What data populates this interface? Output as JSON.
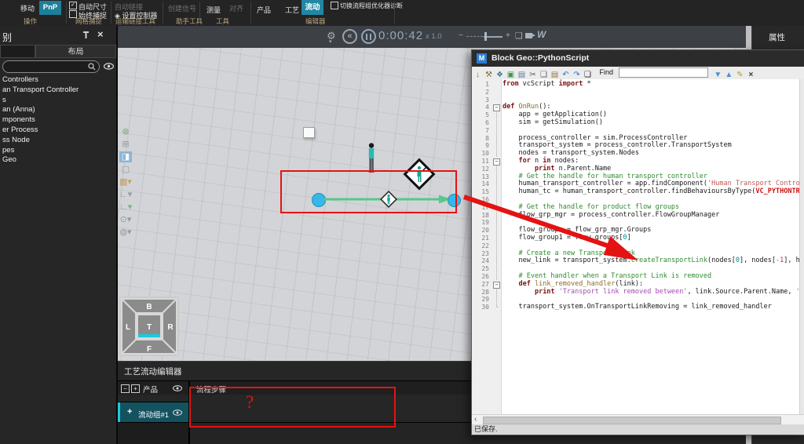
{
  "ribbon": {
    "move_label": "移动",
    "pnp_label": "PnP",
    "group_operation": "操作",
    "auto_size": "自动尺寸",
    "always_snap": "始终捕捉",
    "group_grid_snap": "网格捕捉",
    "auto_link": "自动链接",
    "set_controller": "设置控制器",
    "group_transport_link_tools": "运输链接工具",
    "create_signal": "创建信号",
    "group_helper_tools": "助手工具",
    "measure": "测量",
    "align": "对齐",
    "group_tools": "工具",
    "product": "产品",
    "process": "工艺",
    "flow": "流动",
    "group_editor": "编辑器",
    "toggle_diagnostics": "切换流程组优化器诊断",
    "accent_color": "#1d7f99",
    "check_glyph": "✓"
  },
  "sidebar": {
    "title": "别",
    "tab_layout": "布局",
    "items": [
      "Controllers",
      "an Transport Controller",
      "s",
      "an (Anna)",
      "mponents",
      "er Process",
      "ss Node",
      "pes",
      "Geo"
    ]
  },
  "playback": {
    "time": "0:00:42",
    "speed": "x  1.0",
    "minus": "−",
    "plus": "+"
  },
  "icons": {
    "gear": "⚙",
    "caret": "▾",
    "rewind": "«",
    "doc": "❏",
    "video": "▸",
    "signature": "W",
    "close": "×",
    "search_hint": "",
    "hscroll_left": "‹"
  },
  "viewport": {
    "nav_pad": {
      "back": "B",
      "left": "L",
      "top": "T",
      "right": "R",
      "front": "F"
    },
    "toolbar": [
      {
        "g": "⊛",
        "c": "#5f9f5f",
        "bg": "",
        "caret": false,
        "n": "fill-view-icon"
      },
      {
        "g": "⊞",
        "c": "#8a9096",
        "bg": "",
        "caret": false,
        "n": "fit-view-icon"
      },
      {
        "g": "◨",
        "c": "#ffffff",
        "bg": "#7fb0d6",
        "caret": false,
        "n": "render-mode-icon"
      },
      {
        "g": "▢",
        "c": "#8a9096",
        "bg": "",
        "caret": false,
        "n": "wireframe-icon"
      },
      {
        "g": "▩",
        "c": "#c09a5a",
        "bg": "",
        "caret": true,
        "n": "frames-icon"
      },
      {
        "g": "∟",
        "c": "#8a9096",
        "bg": "",
        "caret": true,
        "n": "origin-frame-icon"
      },
      {
        "g": "∟",
        "c": "#6fae6f",
        "bg": "",
        "caret": true,
        "n": "axes-icon"
      },
      {
        "g": "⊙",
        "c": "#8a9096",
        "bg": "",
        "caret": true,
        "n": "selection-mode-icon"
      },
      {
        "g": "◍",
        "c": "#8a9096",
        "bg": "",
        "caret": true,
        "n": "world-icon"
      }
    ]
  },
  "flow_editor": {
    "title": "工艺流动编辑器",
    "collapse": "−",
    "expand": "+",
    "col_product": "产品",
    "col_steps": "流程步骤",
    "row_plus": "+",
    "row_label": "流动组#1",
    "annotation_question": "?"
  },
  "properties_panel": {
    "title": "属性"
  },
  "script_window": {
    "title": "Block Geo::PythonScript",
    "icon_letter": "M",
    "find_label": "Find",
    "find_value": "",
    "status": "已保存.",
    "toolbar_icons": [
      {
        "g": "↓",
        "c": "#4a7a5a",
        "n": "save-icon"
      },
      {
        "g": "⚒",
        "c": "#8a6a3a",
        "n": "build-icon"
      },
      {
        "g": "❖",
        "c": "#3a7a8a",
        "n": "snippet-icon"
      },
      {
        "g": "▣",
        "c": "#3a9a4f",
        "n": "api-help-icon"
      },
      {
        "g": "▤",
        "c": "#5a7aa0",
        "n": "export-icon"
      },
      {
        "g": "✂",
        "c": "#555555",
        "n": "cut-icon"
      },
      {
        "g": "❏",
        "c": "#555566",
        "n": "copy-icon"
      },
      {
        "g": "▤",
        "c": "#a07040",
        "n": "paste-icon"
      },
      {
        "g": "↶",
        "c": "#2f6fd0",
        "n": "undo-icon"
      },
      {
        "g": "↷",
        "c": "#2f6fd0",
        "n": "redo-icon"
      },
      {
        "g": "❏",
        "c": "#222222",
        "n": "page-icon"
      }
    ],
    "find_buttons": [
      {
        "g": "▼",
        "c": "#4a90d9",
        "n": "find-next-icon"
      },
      {
        "g": "▲",
        "c": "#4a90d9",
        "n": "find-prev-icon"
      },
      {
        "g": "✎",
        "c": "#b09a20",
        "n": "highlight-all-icon"
      },
      {
        "g": "×",
        "c": "#333333",
        "n": "clear-find-icon"
      }
    ],
    "code": {
      "lines": [
        {
          "n": 1,
          "f": "",
          "s": [
            [
              "from",
              "k"
            ],
            [
              " vcScript ",
              "p"
            ],
            [
              "import",
              "k"
            ],
            [
              " *",
              "p"
            ]
          ]
        },
        {
          "n": 2,
          "f": "",
          "s": []
        },
        {
          "n": 3,
          "f": "",
          "s": []
        },
        {
          "n": 4,
          "f": "-",
          "s": [
            [
              "def",
              "k"
            ],
            [
              " ",
              "p"
            ],
            [
              "OnRun",
              "f"
            ],
            [
              "():",
              "p"
            ]
          ]
        },
        {
          "n": 5,
          "f": "|",
          "s": [
            [
              "    app = getApplication()",
              "p"
            ]
          ]
        },
        {
          "n": 6,
          "f": "|",
          "s": [
            [
              "    sim = getSimulation()",
              "p"
            ]
          ]
        },
        {
          "n": 7,
          "f": "|",
          "s": []
        },
        {
          "n": 8,
          "f": "|",
          "s": [
            [
              "    process_controller = sim.ProcessController",
              "p"
            ]
          ]
        },
        {
          "n": 9,
          "f": "|",
          "s": [
            [
              "    transport_system = process_controller.TransportSystem",
              "p"
            ]
          ]
        },
        {
          "n": 10,
          "f": "|",
          "s": [
            [
              "    nodes = transport_system.Nodes",
              "p"
            ]
          ]
        },
        {
          "n": 11,
          "f": "-",
          "s": [
            [
              "    ",
              "p"
            ],
            [
              "for",
              "k"
            ],
            [
              " n ",
              "p"
            ],
            [
              "in",
              "k"
            ],
            [
              " nodes:",
              "p"
            ]
          ]
        },
        {
          "n": 12,
          "f": "|",
          "s": [
            [
              "        ",
              "p"
            ],
            [
              "print",
              "k"
            ],
            [
              " n.Parent.Name",
              "p"
            ]
          ]
        },
        {
          "n": 13,
          "f": "|",
          "s": [
            [
              "    # Get the handle for human transport controller",
              "c"
            ]
          ]
        },
        {
          "n": 14,
          "f": "|",
          "s": [
            [
              "    human_transport_controller = app.findComponent(",
              "p"
            ],
            [
              "'Human Transport Controll",
              "s1"
            ]
          ]
        },
        {
          "n": 15,
          "f": "|",
          "s": [
            [
              "    human_tc = human_transport_controller.findBehavioursByType(",
              "p"
            ],
            [
              "VC_PYTHONTRAN",
              "t"
            ]
          ]
        },
        {
          "n": 16,
          "f": "|",
          "s": []
        },
        {
          "n": 17,
          "f": "|",
          "s": [
            [
              "    # Get the handle for product flow groups",
              "c"
            ]
          ]
        },
        {
          "n": 18,
          "f": "|",
          "s": [
            [
              "    flow_grp_mgr = process_controller.FlowGroupManager",
              "p"
            ]
          ]
        },
        {
          "n": 19,
          "f": "|",
          "s": []
        },
        {
          "n": 20,
          "f": "|",
          "s": [
            [
              "    flow_groups = flow_grp_mgr.Groups",
              "p"
            ]
          ]
        },
        {
          "n": 21,
          "f": "|",
          "s": [
            [
              "    flow_group1 = flow_groups[",
              "p"
            ],
            [
              "0",
              "n"
            ],
            [
              "]",
              "p"
            ]
          ]
        },
        {
          "n": 22,
          "f": "|",
          "s": []
        },
        {
          "n": 23,
          "f": "|",
          "s": [
            [
              "    # Create a new Transport Link",
              "c"
            ]
          ]
        },
        {
          "n": 24,
          "f": "|",
          "s": [
            [
              "    new_link = transport_system.",
              "p"
            ],
            [
              "createTransportLink",
              "g"
            ],
            [
              "(nodes[",
              "p"
            ],
            [
              "0",
              "n"
            ],
            [
              "], nodes[",
              "p"
            ],
            [
              "-1",
              "neg"
            ],
            [
              "], hum",
              "p"
            ]
          ]
        },
        {
          "n": 25,
          "f": "|",
          "s": []
        },
        {
          "n": 26,
          "f": "|",
          "s": [
            [
              "    # Event handler when a Transport Link is removed",
              "c"
            ]
          ]
        },
        {
          "n": 27,
          "f": "-",
          "s": [
            [
              "    ",
              "p"
            ],
            [
              "def",
              "k"
            ],
            [
              " ",
              "p"
            ],
            [
              "link_removed_handler",
              "f"
            ],
            [
              "(link):",
              "p"
            ]
          ]
        },
        {
          "n": 28,
          "f": "|",
          "s": [
            [
              "        ",
              "p"
            ],
            [
              "print",
              "k"
            ],
            [
              " ",
              "p"
            ],
            [
              "'Transport link removed between'",
              "s2"
            ],
            [
              ", link.Source.Parent.Name, ",
              "p"
            ],
            [
              "'an",
              "s2"
            ]
          ]
        },
        {
          "n": 29,
          "f": "|",
          "s": []
        },
        {
          "n": 30,
          "f": "L",
          "s": [
            [
              "    transport_system.OnTransportLinkRemoving = link_removed_handler",
              "p"
            ]
          ]
        }
      ]
    }
  },
  "annotation_colors": {
    "red": "#e51212"
  }
}
